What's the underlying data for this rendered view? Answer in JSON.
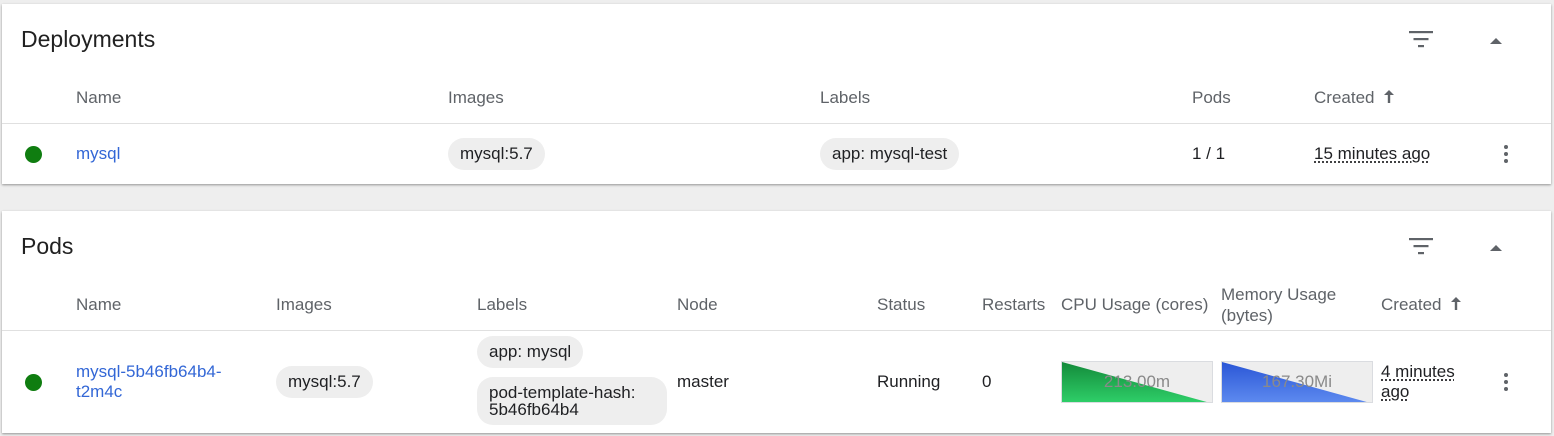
{
  "deployments": {
    "title": "Deployments",
    "columns": {
      "name": "Name",
      "images": "Images",
      "labels": "Labels",
      "pods": "Pods",
      "created": "Created"
    },
    "rows": [
      {
        "status": "running",
        "name": "mysql",
        "image": "mysql:5.7",
        "label": "app: mysql-test",
        "pods": "1 / 1",
        "created": "15 minutes ago"
      }
    ]
  },
  "pods": {
    "title": "Pods",
    "columns": {
      "name": "Name",
      "images": "Images",
      "labels": "Labels",
      "node": "Node",
      "status": "Status",
      "restarts": "Restarts",
      "cpu": "CPU Usage (cores)",
      "memory_line1": "Memory Usage",
      "memory_line2": "(bytes)",
      "created": "Created"
    },
    "rows": [
      {
        "name_line1": "mysql-5b46fb64b4-",
        "name_line2": "t2m4c",
        "image": "mysql:5.7",
        "labels": [
          "app: mysql",
          "pod-template-hash: 5b46fb64b4"
        ],
        "node": "master",
        "status": "Running",
        "restarts": "0",
        "cpu": "213.00m",
        "memory": "167.30Mi",
        "created_line1": "4 minutes",
        "created_line2": "ago"
      }
    ]
  },
  "colors": {
    "status_ok": "#0f7d10",
    "link": "#3367d6",
    "cpu_spark": "#1fbf55",
    "memory_spark": "#3f6fe0"
  },
  "icons": [
    "filter-icon",
    "collapse-icon",
    "sort-arrow-up-icon",
    "more-vert-icon"
  ]
}
